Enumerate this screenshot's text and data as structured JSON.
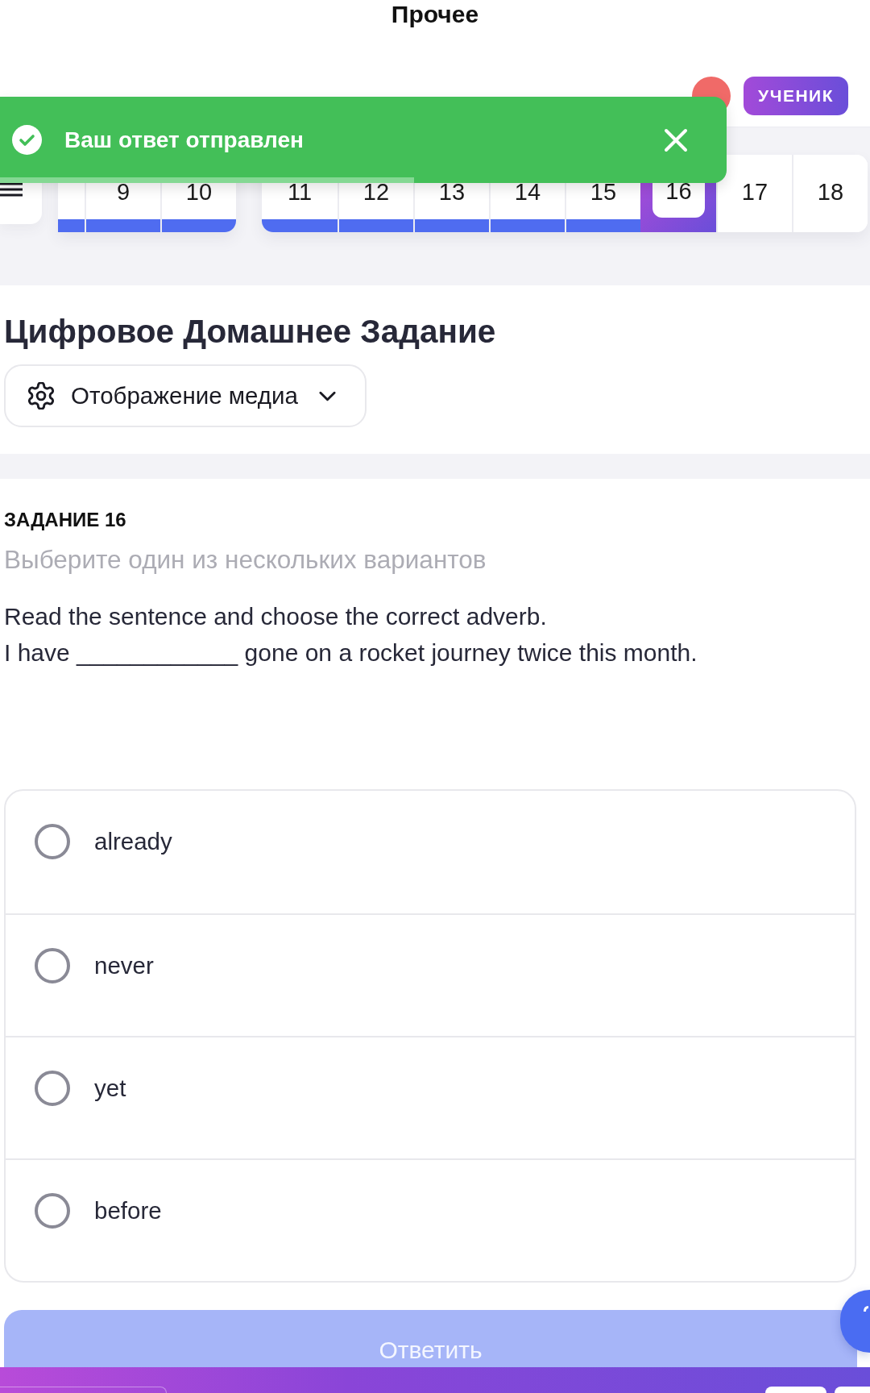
{
  "page_title": "Прочее",
  "header": {
    "role_badge": "УЧЕНИК"
  },
  "toast": {
    "kind": "success",
    "message": "Ваш ответ отправлен",
    "timer": {
      "level": 0.57
    }
  },
  "question_nav": {
    "groups": [
      {
        "tabs": [
          {
            "answered": true,
            "selected": false
          },
          {
            "label": "9",
            "answered": true,
            "selected": false
          },
          {
            "label": "10",
            "answered": true,
            "selected": false
          }
        ]
      },
      {
        "tabs": [
          {
            "label": "11",
            "answered": true,
            "selected": false
          },
          {
            "label": "12",
            "answered": true,
            "selected": false
          },
          {
            "label": "13",
            "answered": true,
            "selected": false
          },
          {
            "label": "14",
            "answered": true,
            "selected": false
          },
          {
            "label": "15",
            "answered": true,
            "selected": false
          },
          {
            "label": "16",
            "answered": false,
            "selected": true
          },
          {
            "label": "17",
            "answered": false,
            "selected": false
          },
          {
            "label": "18",
            "answered": false,
            "selected": false
          }
        ]
      }
    ]
  },
  "title": "Цифровое Домашнее Задание",
  "media_dropdown": {
    "label": "Отображение медиа"
  },
  "task": {
    "heading": "ЗАДАНИЕ 16",
    "instruction": "Выберите один из нескольких вариантов",
    "text_lines": [
      "Read the sentence and choose the correct adverb.",
      "I have ____________ gone on a rocket journey twice this month."
    ]
  },
  "options": [
    {
      "label": "already",
      "selected": false
    },
    {
      "label": "never",
      "selected": false
    },
    {
      "label": "yet",
      "selected": false
    },
    {
      "label": "before",
      "selected": false
    }
  ],
  "answer_button": {
    "label": "Ответить",
    "disabled": true
  }
}
